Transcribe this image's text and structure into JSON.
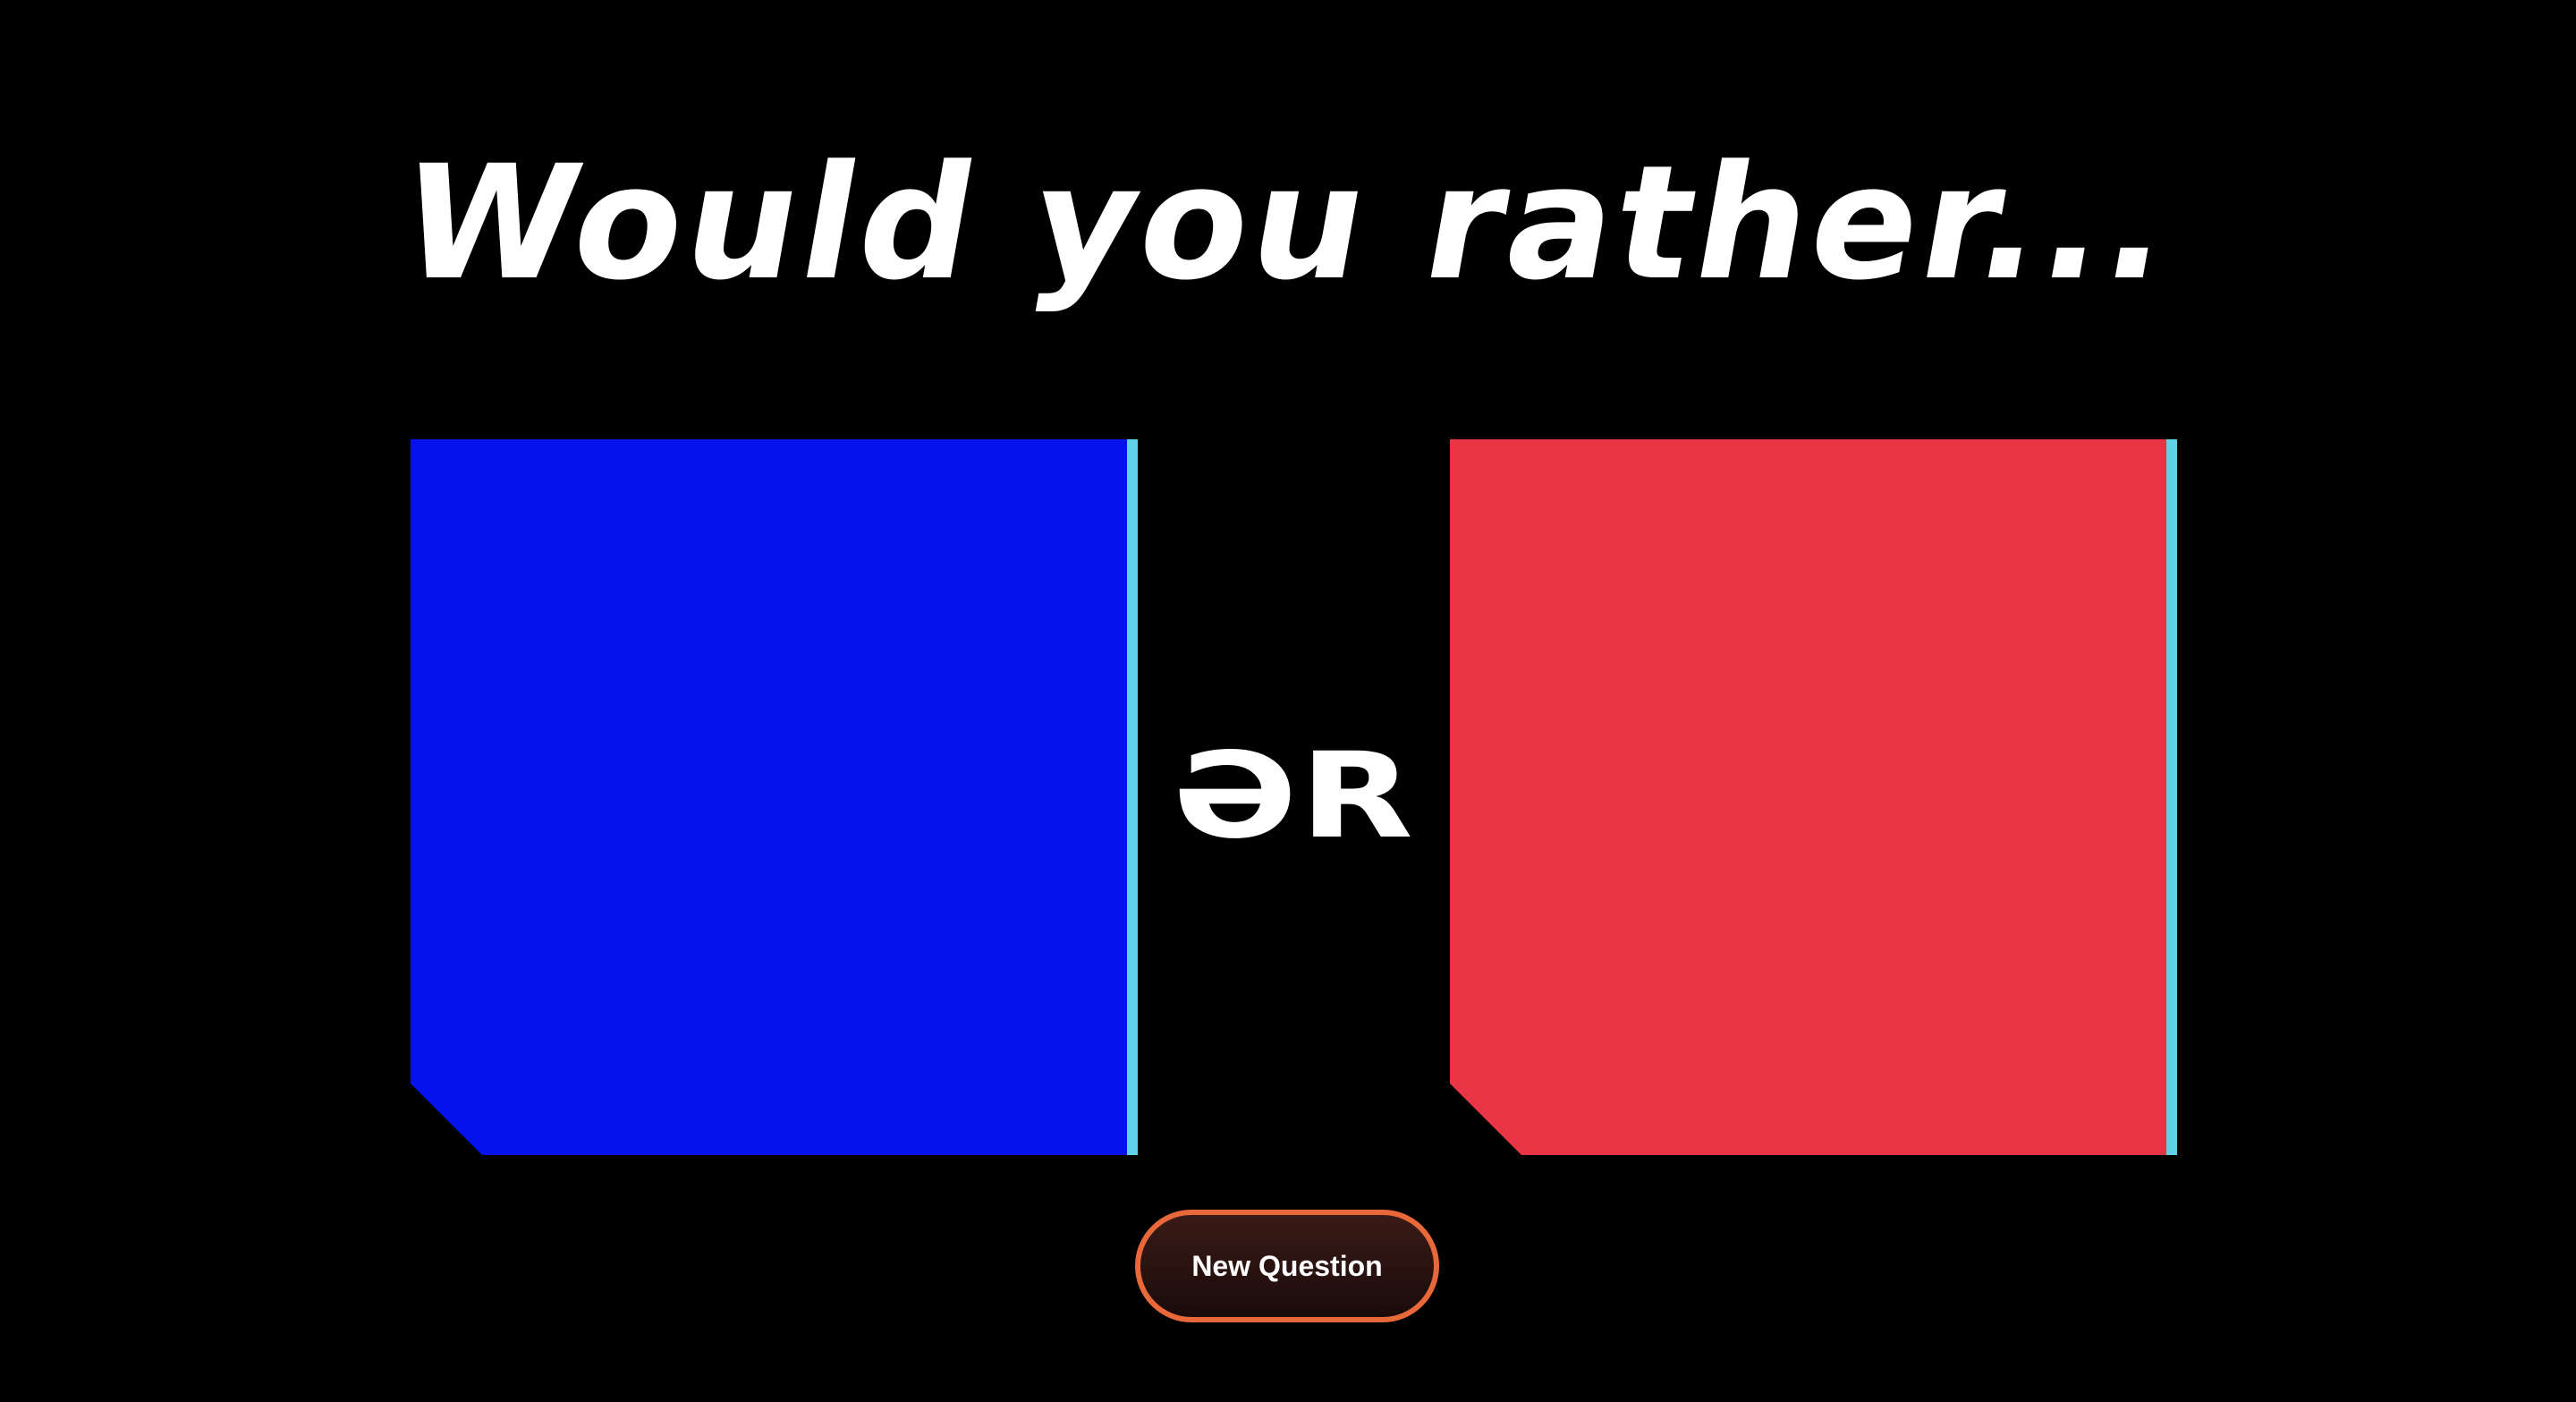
{
  "header": {
    "title": "Would you rather..."
  },
  "options": [
    {
      "fill_color": "#0512ee",
      "edge_color": "#5ed3e8",
      "text": ""
    },
    {
      "fill_color": "#e93446",
      "edge_color": "#5ed3e8",
      "text": ""
    }
  ],
  "divider": {
    "label": "ƏR"
  },
  "actions": {
    "new_question_label": "New Question",
    "button_border_color": "#e8683a"
  }
}
